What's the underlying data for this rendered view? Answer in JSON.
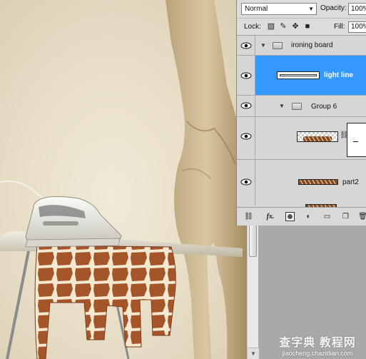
{
  "layers_panel": {
    "blend_mode": "Normal",
    "opacity_label": "Opacity:",
    "opacity_value": "100%",
    "lock_label": "Lock:",
    "fill_label": "Fill:",
    "fill_value": "100%",
    "layers": [
      {
        "name": "ironing board",
        "type": "group",
        "expanded": true,
        "visible": true
      },
      {
        "name": "light line",
        "type": "layer",
        "selected": true,
        "visible": true
      },
      {
        "name": "Group 6",
        "type": "group",
        "expanded": true,
        "visible": true
      },
      {
        "name": "",
        "type": "layer-with-mask",
        "visible": true
      },
      {
        "name": "part2",
        "type": "layer",
        "visible": true
      }
    ],
    "bottom_icons": [
      "link-icon",
      "fx-icon",
      "mask-icon",
      "adjustment-icon",
      "new-group-icon",
      "new-layer-icon",
      "trash-icon"
    ],
    "fx_label": "fx."
  },
  "watermark": {
    "title": "查字典 教程网",
    "url": "jiaocheng.chazidian.com"
  },
  "colors": {
    "selection": "#3399ff",
    "panel": "#d6d6d6",
    "canvas_bg": "#ece3cf"
  }
}
